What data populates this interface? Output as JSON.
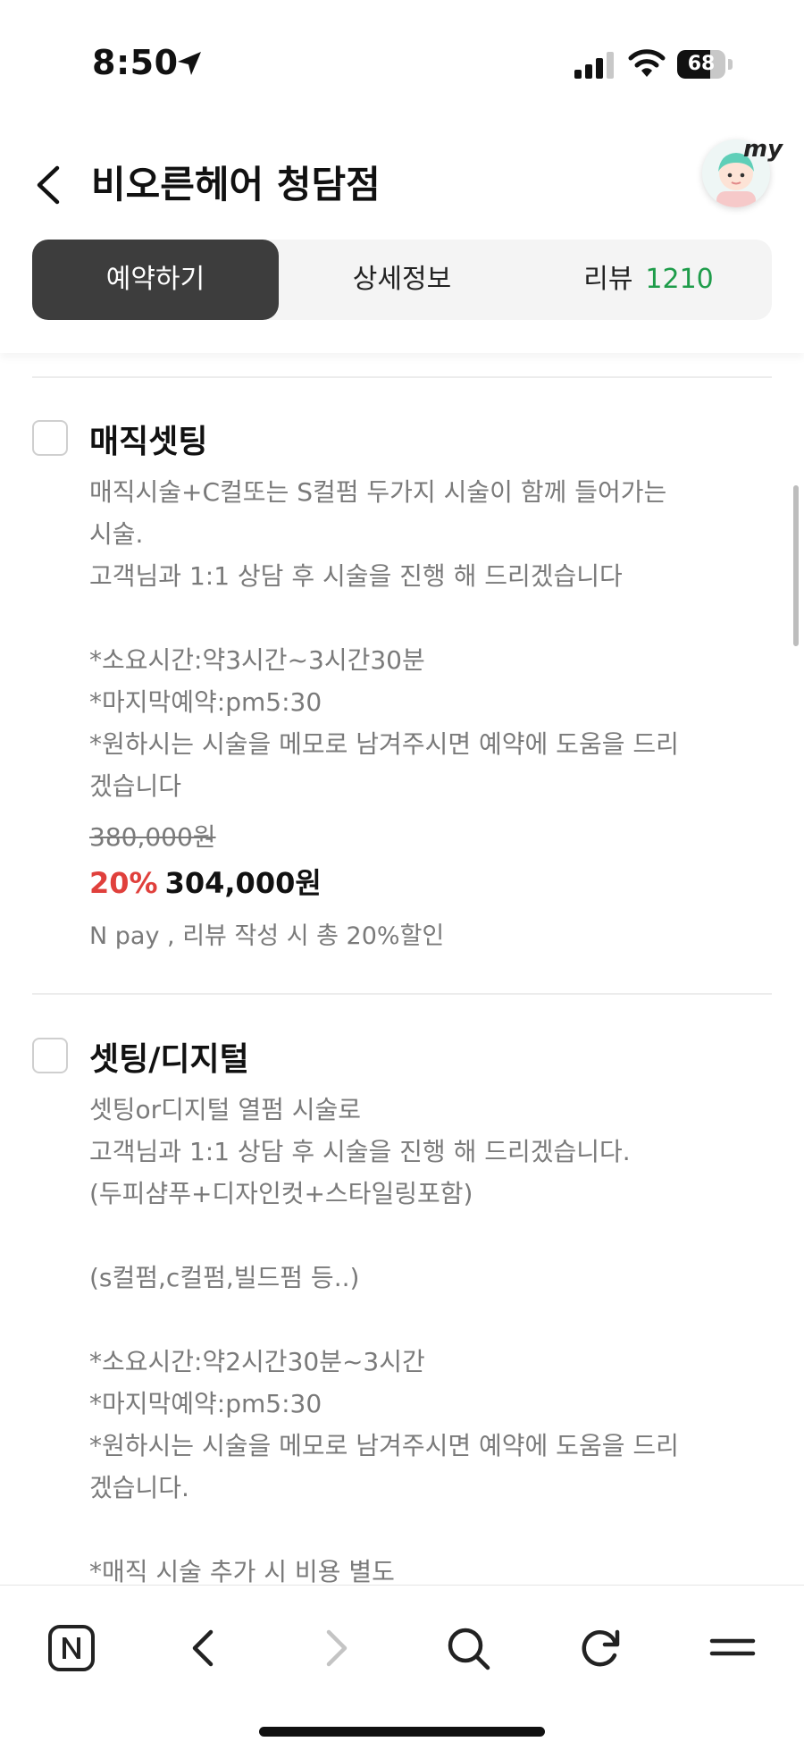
{
  "status": {
    "time": "8:50",
    "battery": "68",
    "battery_level": 0.68
  },
  "header": {
    "title": "비오른헤어 청담점",
    "my_label": "my",
    "tabs": [
      {
        "label": "예약하기",
        "count": "",
        "active": true
      },
      {
        "label": "상세정보",
        "count": "",
        "active": false
      },
      {
        "label": "리뷰",
        "count": "1210",
        "active": false
      }
    ]
  },
  "items": [
    {
      "title": "매직셋팅",
      "lines": [
        "매직시술+C컬또는 S컬펌 두가지 시술이 함께 들어가는",
        "시술.",
        "고객님과 1:1 상담 후 시술을 진행 해 드리겠습니다",
        "",
        "*소요시간:약3시간~3시간30분",
        "*마지막예약:pm5:30",
        "*원하시는 시술을 메모로 남겨주시면 예약에 도움을 드리",
        "겠습니다"
      ],
      "original_price": "380,000원",
      "discount": "20%",
      "price": "304,000원",
      "benefit": "N pay , 리뷰 작성 시 총 20%할인"
    },
    {
      "title": "셋팅/디지털",
      "lines": [
        "셋팅or디지털 열펌 시술로",
        "고객님과 1:1 상담 후 시술을 진행 해 드리겠습니다.",
        "(두피샴푸+디자인컷+스타일링포함)",
        "",
        "(s컬펌,c컬펌,빌드펌 등..)",
        "",
        "*소요시간:약2시간30분~3시간",
        "*마지막예약:pm5:30",
        "*원하시는 시술을 메모로 남겨주시면 예약에 도움을 드리",
        "겠습니다.",
        "",
        "*매직 시술 추가 시 비용 별도"
      ]
    }
  ],
  "bottom_nav": [
    {
      "icon": "naver-home-icon"
    },
    {
      "icon": "back-arrow-icon"
    },
    {
      "icon": "forward-arrow-icon"
    },
    {
      "icon": "search-icon"
    },
    {
      "icon": "refresh-icon"
    },
    {
      "icon": "menu-icon"
    }
  ],
  "colors": {
    "active_tab": "#3d3d3d",
    "review_count": "#1e9c4a",
    "discount": "#e0403c",
    "description": "#7a7a7a"
  }
}
